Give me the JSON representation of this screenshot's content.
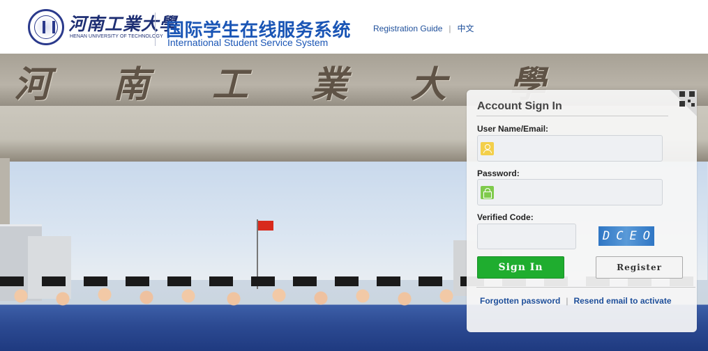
{
  "header": {
    "university_cn": "河南工業大學",
    "university_en": "HENAN UNIVERSITY OF TECHNOLOGY",
    "system_cn": "国际学生在线服务系统",
    "system_en": "International Student Service System",
    "nav": {
      "registration_guide": "Registration Guide",
      "separator": "|",
      "language": "中文"
    }
  },
  "hero": {
    "gate_text": "河南工業大學"
  },
  "login": {
    "title": "Account Sign In",
    "username_label": "User Name/Email:",
    "username_value": "",
    "password_label": "Password:",
    "password_value": "",
    "code_label": "Verified Code:",
    "code_value": "",
    "captcha_text": "DCEO",
    "signin_label": "Sign In",
    "register_label": "Register",
    "forgot_label": "Forgotten password",
    "links_separator": "|",
    "resend_label": "Resend email to activate"
  },
  "colors": {
    "brand_blue": "#1a55b5",
    "signin_green": "#1fad2f",
    "user_icon_yellow": "#f3cf4a",
    "lock_icon_green": "#7fcb4c"
  },
  "icons": [
    "university-seal-icon",
    "user-icon",
    "lock-icon",
    "qr-code-icon"
  ]
}
